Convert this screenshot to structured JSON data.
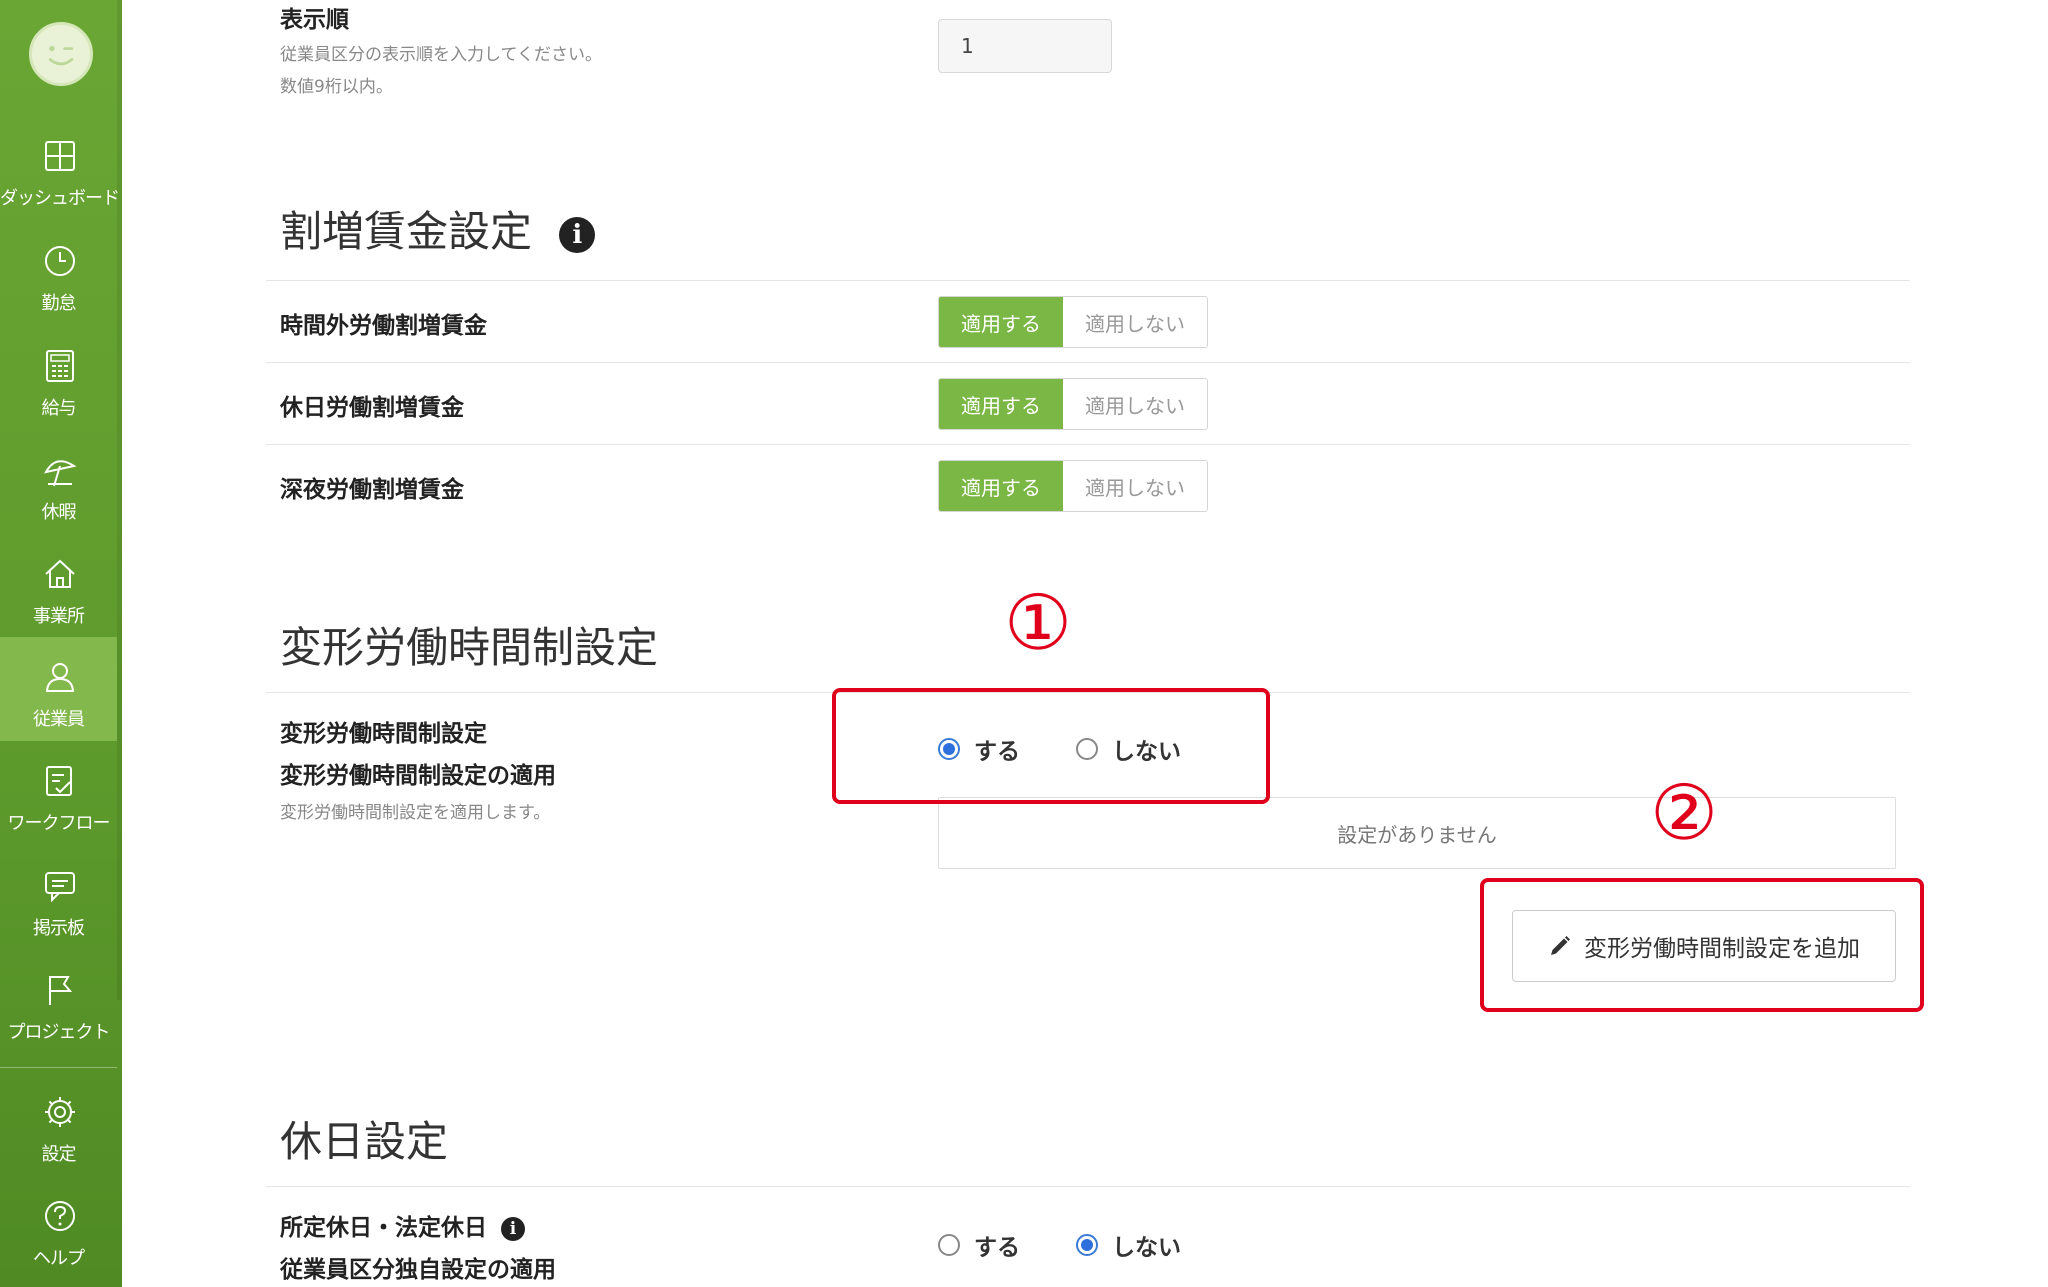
{
  "sidebar": {
    "items": [
      {
        "label": "ダッシュボード",
        "icon": "dashboard-grid-icon"
      },
      {
        "label": "勤怠",
        "icon": "clock-icon"
      },
      {
        "label": "給与",
        "icon": "calculator-icon"
      },
      {
        "label": "休暇",
        "icon": "beach-umbrella-icon"
      },
      {
        "label": "事業所",
        "icon": "home-icon"
      },
      {
        "label": "従業員",
        "icon": "person-icon"
      },
      {
        "label": "ワークフロー",
        "icon": "checklist-icon"
      },
      {
        "label": "掲示板",
        "icon": "chat-bubble-icon"
      },
      {
        "label": "プロジェクト",
        "icon": "flag-icon"
      },
      {
        "label": "設定",
        "icon": "gear-icon"
      },
      {
        "label": "ヘルプ",
        "icon": "question-icon"
      }
    ],
    "active": "従業員",
    "accent_color": "#6aa634"
  },
  "display_order": {
    "label": "表示順",
    "hint1": "従業員区分の表示順を入力してください。",
    "hint2": "数値9桁以内。",
    "value": "1"
  },
  "premium_wage": {
    "title": "割増賃金設定",
    "rows": [
      {
        "label": "時間外労働割増賃金",
        "on": "適用する",
        "off": "適用しない"
      },
      {
        "label": "休日労働割増賃金",
        "on": "適用する",
        "off": "適用しない"
      },
      {
        "label": "深夜労働割増賃金",
        "on": "適用する",
        "off": "適用しない"
      }
    ],
    "on_color": "#7ab744"
  },
  "flex": {
    "title": "変形労働時間制設定",
    "label1": "変形労働時間制設定",
    "label2": "変形労働時間制設定の適用",
    "hint": "変形労働時間制設定を適用します。",
    "opt_yes": "する",
    "opt_no": "しない",
    "selected": "する",
    "empty_text": "設定がありません",
    "add_button": "変形労働時間制設定を追加"
  },
  "holiday": {
    "title": "休日設定",
    "label1": "所定休日・法定休日",
    "label2": "従業員区分独自設定の適用",
    "opt_yes": "する",
    "opt_no": "しない",
    "selected": "しない"
  },
  "annotations": {
    "one": "①",
    "two": "②",
    "color": "#e0001b"
  }
}
